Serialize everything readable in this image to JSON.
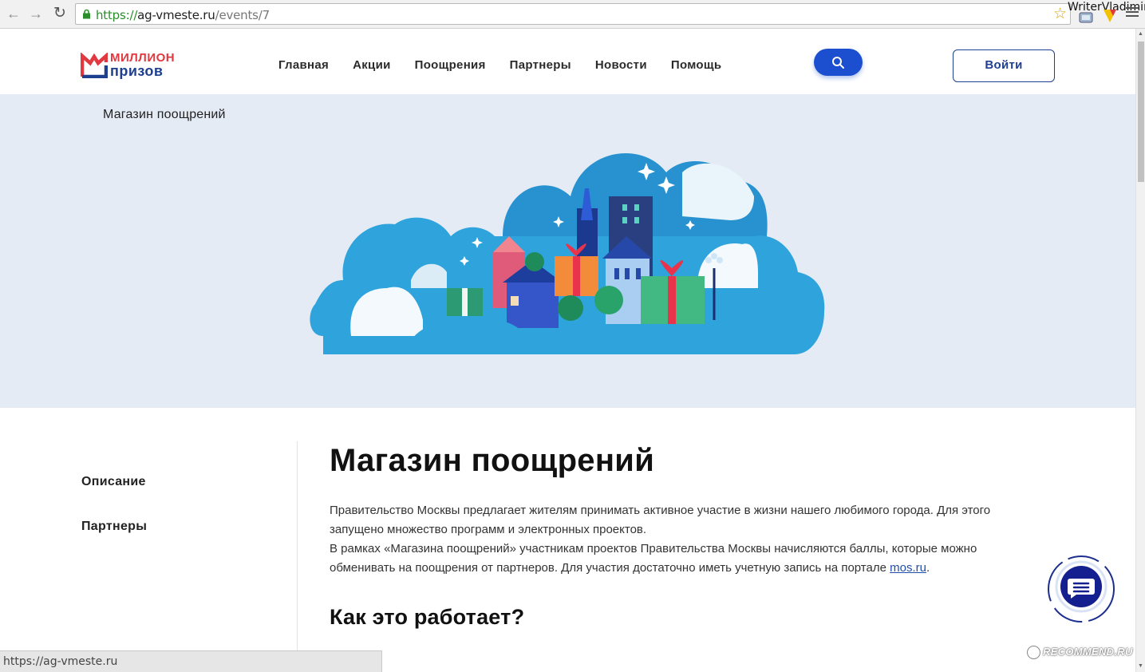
{
  "browser": {
    "url_protocol": "https://",
    "url_host": "ag-vmeste.ru",
    "url_path": "/events/7",
    "profile_name": "WriterVladimir",
    "status_text": "https://ag-vmeste.ru"
  },
  "header": {
    "logo_line1": "МИЛЛИОН",
    "logo_line2": "призов",
    "nav": [
      "Главная",
      "Акции",
      "Поощрения",
      "Партнеры",
      "Новости",
      "Помощь"
    ],
    "login_label": "Войти"
  },
  "hero": {
    "title": "Магазин поощрений"
  },
  "side_nav": {
    "items": [
      "Описание",
      "Партнеры"
    ]
  },
  "content": {
    "title": "Магазин поощрений",
    "intro_line1": "Правительство Москвы предлагает жителям принимать активное участие в жизни нашего любимого города. Для этого запущено множество программ и электронных проектов.",
    "intro_line2": "В рамках «Магазина поощрений» участникам проектов Правительства Москвы начисляются баллы, которые можно обменивать на поощрения от партнеров. Для участия достаточно иметь учетную запись на портале ",
    "intro_link": "mos.ru",
    "intro_end": ".",
    "section_title": "Как это работает?"
  },
  "watermark": "RECOMMEND.RU",
  "colors": {
    "brand_blue": "#1f3f8f",
    "brand_red": "#e2383f",
    "search_blue": "#1c4fd0",
    "hero_bg": "#e4ebf5",
    "cloud_blue": "#2ea3dc"
  }
}
